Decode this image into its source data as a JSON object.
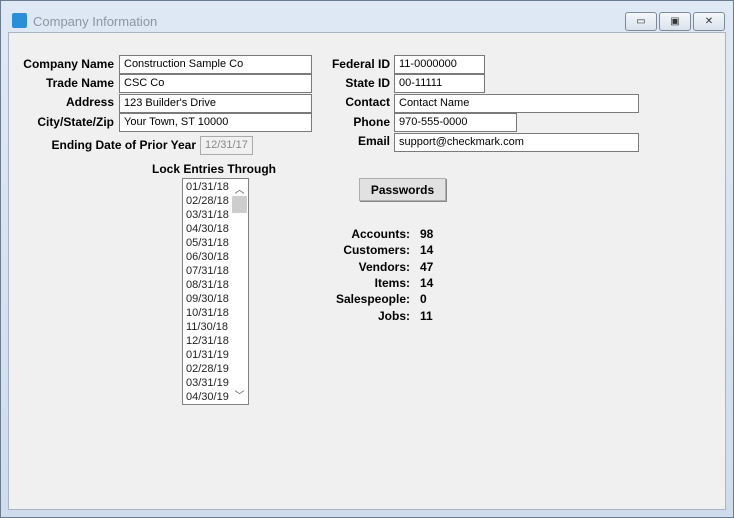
{
  "window": {
    "title": "Company Information",
    "controls": {
      "minimize": "▭",
      "maximize": "▣",
      "close": "✕"
    }
  },
  "fields": {
    "company_name": {
      "label": "Company Name",
      "value": "Construction Sample Co"
    },
    "trade_name": {
      "label": "Trade Name",
      "value": "CSC Co"
    },
    "address": {
      "label": "Address",
      "value": "123 Builder's Drive"
    },
    "city_state_zip": {
      "label": "City/State/Zip",
      "value": "Your Town, ST  10000"
    },
    "prior_year_end": {
      "label": "Ending Date of Prior Year",
      "value": "12/31/17"
    },
    "federal_id": {
      "label": "Federal ID",
      "value": "11-0000000"
    },
    "state_id": {
      "label": "State ID",
      "value": "00-11111"
    },
    "contact": {
      "label": "Contact",
      "value": "Contact Name"
    },
    "phone": {
      "label": "Phone",
      "value": "970-555-0000"
    },
    "email": {
      "label": "Email",
      "value": "support@checkmark.com"
    }
  },
  "lock": {
    "label": "Lock Entries Through",
    "items": [
      "01/31/18",
      "02/28/18",
      "03/31/18",
      "04/30/18",
      "05/31/18",
      "06/30/18",
      "07/31/18",
      "08/31/18",
      "09/30/18",
      "10/31/18",
      "11/30/18",
      "12/31/18",
      "01/31/19",
      "02/28/19",
      "03/31/19",
      "04/30/19"
    ]
  },
  "passwords_label": "Passwords",
  "stats": [
    {
      "label": "Accounts:",
      "value": "98"
    },
    {
      "label": "Customers:",
      "value": "14"
    },
    {
      "label": "Vendors:",
      "value": "47"
    },
    {
      "label": "Items:",
      "value": "14"
    },
    {
      "label": "Salespeople:",
      "value": "0"
    },
    {
      "label": "Jobs:",
      "value": "11"
    }
  ]
}
